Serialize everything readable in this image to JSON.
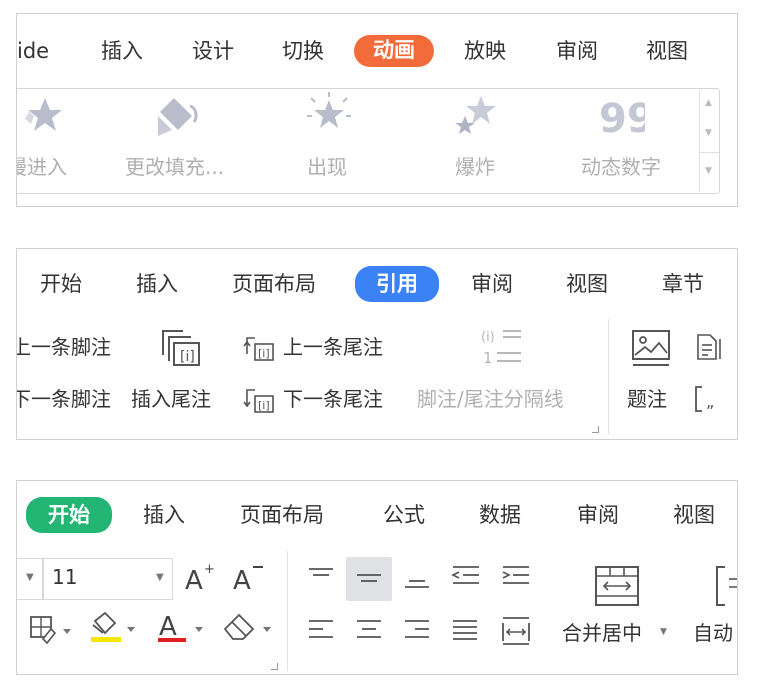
{
  "colors": {
    "animation_tab": "#f26b3a",
    "reference_tab": "#3b82f6",
    "home_tab": "#22b573",
    "font_highlight_bar": "#f3e600",
    "font_color_bar": "#e02020"
  },
  "panel1": {
    "tabs": [
      "ide",
      "插入",
      "设计",
      "切换",
      "动画",
      "放映",
      "审阅",
      "视图"
    ],
    "active_tab": "动画",
    "gallery": [
      {
        "label": "慢进入",
        "icon": "star-fade-icon"
      },
      {
        "label": "更改填充...",
        "icon": "paint-bucket-icon"
      },
      {
        "label": "出现",
        "icon": "star-burst-icon"
      },
      {
        "label": "爆炸",
        "icon": "star-explode-icon"
      },
      {
        "label": "动态数字",
        "icon": "number-99-icon"
      }
    ]
  },
  "panel2": {
    "tabs": [
      "开始",
      "插入",
      "页面布局",
      "引用",
      "审阅",
      "视图",
      "章节"
    ],
    "active_tab": "引用",
    "buttons": {
      "prev_footnote": "上一条脚注",
      "next_footnote": "下一条脚注",
      "insert_endnote": "插入尾注",
      "prev_endnote": "上一条尾注",
      "next_endnote": "下一条尾注",
      "separator": "脚注/尾注分隔线",
      "caption": "题注"
    }
  },
  "panel3": {
    "tabs": [
      "开始",
      "插入",
      "页面布局",
      "公式",
      "数据",
      "审阅",
      "视图"
    ],
    "active_tab": "开始",
    "font_size": "11",
    "merge_label": "合并居中",
    "autowrap_label": "自动"
  }
}
